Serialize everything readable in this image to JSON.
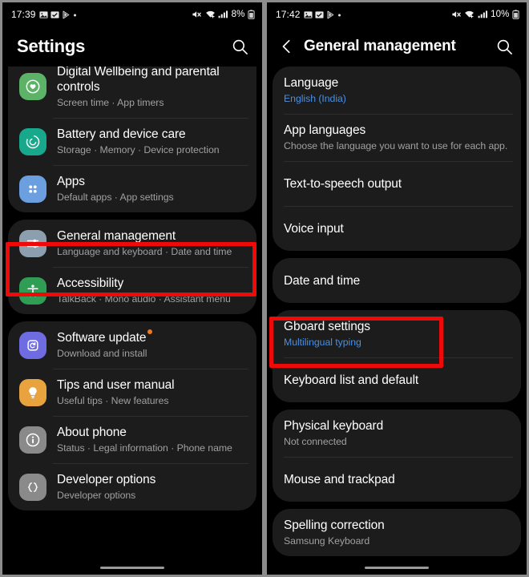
{
  "left_phone": {
    "status_bar": {
      "time": "17:39",
      "battery_percent": "8%",
      "icons": [
        "gallery-icon",
        "checkbox-icon",
        "play-store-icon",
        "dot-icon",
        "mute-icon",
        "wifi-icon",
        "signal-icon",
        "battery-icon"
      ]
    },
    "header": {
      "title": "Settings",
      "search_icon": "search-icon"
    },
    "groups": [
      {
        "clipped_top": true,
        "items": [
          {
            "title": "Digital Wellbeing and parental controls",
            "subtitle": "Screen time  ·  App timers",
            "icon": "wellbeing-icon",
            "icon_color": "#5cb367",
            "badge": false,
            "highlighted": false
          },
          {
            "title": "Battery and device care",
            "subtitle": "Storage  ·  Memory  ·  Device protection",
            "icon": "battery-care-icon",
            "icon_color": "#18a88c",
            "badge": false,
            "highlighted": false
          },
          {
            "title": "Apps",
            "subtitle": "Default apps  ·  App settings",
            "icon": "apps-icon",
            "icon_color": "#6b9fe0",
            "badge": false,
            "highlighted": false
          }
        ]
      },
      {
        "clipped_top": false,
        "items": [
          {
            "title": "General management",
            "subtitle": "Language and keyboard  ·  Date and time",
            "icon": "sliders-icon",
            "icon_color": "#8c9fae",
            "badge": false,
            "highlighted": true
          },
          {
            "title": "Accessibility",
            "subtitle": "TalkBack  ·  Mono audio  ·  Assistant menu",
            "icon": "accessibility-icon",
            "icon_color": "#2f9e54",
            "badge": false,
            "highlighted": false
          }
        ]
      },
      {
        "clipped_top": false,
        "items": [
          {
            "title": "Software update",
            "subtitle": "Download and install",
            "icon": "software-update-icon",
            "icon_color": "#6e6ce0",
            "badge": true,
            "badge_color": "#f07820",
            "highlighted": false
          },
          {
            "title": "Tips and user manual",
            "subtitle": "Useful tips  ·  New features",
            "icon": "lightbulb-icon",
            "icon_color": "#e8a23e",
            "badge": false,
            "highlighted": false
          },
          {
            "title": "About phone",
            "subtitle": "Status  ·  Legal information  ·  Phone name",
            "icon": "info-icon",
            "icon_color": "#8a8a8a",
            "badge": false,
            "highlighted": false
          },
          {
            "title": "Developer options",
            "subtitle": "Developer options",
            "icon": "code-braces-icon",
            "icon_color": "#8a8a8a",
            "badge": false,
            "highlighted": false
          }
        ]
      }
    ]
  },
  "right_phone": {
    "status_bar": {
      "time": "17:42",
      "battery_percent": "10%",
      "icons": [
        "gallery-icon",
        "checkbox-icon",
        "play-store-icon",
        "dot-icon",
        "mute-icon",
        "wifi-icon",
        "signal-icon",
        "battery-icon"
      ]
    },
    "header": {
      "back_icon": "back-chevron-icon",
      "title": "General management",
      "search_icon": "search-icon"
    },
    "groups": [
      {
        "items": [
          {
            "title": "Language",
            "subtitle": "English (India)",
            "subtitle_accent": true,
            "highlighted": false
          },
          {
            "title": "App languages",
            "subtitle": "Choose the language you want to use for each app.",
            "subtitle_accent": false,
            "highlighted": false
          },
          {
            "title": "Text-to-speech output",
            "subtitle": "",
            "subtitle_accent": false,
            "highlighted": false
          },
          {
            "title": "Voice input",
            "subtitle": "",
            "subtitle_accent": false,
            "highlighted": false
          }
        ]
      },
      {
        "items": [
          {
            "title": "Date and time",
            "subtitle": "",
            "subtitle_accent": false,
            "highlighted": false
          }
        ]
      },
      {
        "items": [
          {
            "title": "Gboard settings",
            "subtitle": "Multilingual typing",
            "subtitle_accent": true,
            "highlighted": true
          },
          {
            "title": "Keyboard list and default",
            "subtitle": "",
            "subtitle_accent": false,
            "highlighted": false
          }
        ]
      },
      {
        "items": [
          {
            "title": "Physical keyboard",
            "subtitle": "Not connected",
            "subtitle_accent": false,
            "highlighted": false
          },
          {
            "title": "Mouse and trackpad",
            "subtitle": "",
            "subtitle_accent": false,
            "highlighted": false
          }
        ]
      },
      {
        "items": [
          {
            "title": "Spelling correction",
            "subtitle": "Samsung Keyboard",
            "subtitle_accent": false,
            "highlighted": false
          }
        ]
      }
    ]
  },
  "annotation": {
    "highlight_color": "#ef0a0a",
    "boxes": [
      {
        "target": "General management",
        "panel": "left"
      },
      {
        "target": "Gboard settings",
        "panel": "right"
      }
    ]
  }
}
